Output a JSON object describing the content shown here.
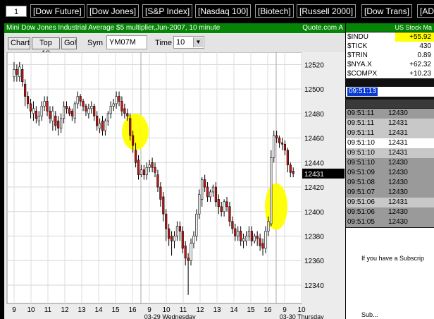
{
  "topbar": {
    "page_number": "1",
    "buttons": [
      "[Dow Future]",
      "[Dow Jones]",
      "[S&P Index]",
      "[Nasdaq 100]",
      "[Biotech]",
      "[Russell 2000]",
      "[Dow Trans]",
      "[AD"
    ]
  },
  "chart_window": {
    "title": "Mini Dow Jones Industrial Average $5 multiplier,Jun-2007, 10 minute",
    "source": "Quote.com  A",
    "chart_button": "Chart",
    "top10_button": "Top 10",
    "go_button": "Go!",
    "sym_label": "Sym",
    "sym_value": "YM07M",
    "time_label": "Time",
    "time_value": "10"
  },
  "chart_data": {
    "type": "candlestick",
    "ylim": [
      12325,
      12530
    ],
    "y_ticks": [
      12520,
      12500,
      12480,
      12460,
      12440,
      12420,
      12400,
      12380,
      12360,
      12340
    ],
    "x_tick_labels": [
      "9",
      "10",
      "11",
      "12",
      "13",
      "14",
      "15",
      "16",
      "9",
      "10",
      "11",
      "12",
      "13",
      "14",
      "15",
      "16",
      "9",
      "10"
    ],
    "x_date_labels": [
      "03-29 Wednesday",
      "03-30 Thursday"
    ],
    "last_price": "12431",
    "highlights": [
      "yellow marker near 12460 at end of day 1",
      "yellow marker near 12400 at end of day 2"
    ],
    "colors": {
      "up": "#ffffff",
      "down": "#cc1111",
      "last_price_bg": "#000000",
      "highlight": "#ffff00"
    },
    "close": [
      12516,
      12512,
      12518,
      12506,
      12494,
      12488,
      12482,
      12484,
      12476,
      12478,
      12486,
      12490,
      12482,
      12476,
      12482,
      12470,
      12468,
      12476,
      12486,
      12484,
      12480,
      12478,
      12488,
      12494,
      12490,
      12486,
      12482,
      12484,
      12486,
      12478,
      12470,
      12472,
      12466,
      12474,
      12480,
      12486,
      12488,
      12494,
      12490,
      12482,
      12480,
      12478,
      12462,
      12454,
      12440,
      12430,
      12434,
      12430,
      12436,
      12438,
      12436,
      12432,
      12420,
      12410,
      12398,
      12386,
      12378,
      12376,
      12380,
      12388,
      12384,
      12370,
      12362,
      12360,
      12374,
      12380,
      12398,
      12414,
      12426,
      12420,
      12412,
      12416,
      12420,
      12408,
      12404,
      12400,
      12408,
      12404,
      12392,
      12386,
      12380,
      12384,
      12376,
      12378,
      12380,
      12384,
      12376,
      12380,
      12378,
      12372,
      12370,
      12384,
      12392,
      12444,
      12462,
      12460,
      12456,
      12455,
      12450,
      12438,
      12432,
      12431
    ],
    "open": [
      12510,
      12516,
      12510,
      12516,
      12504,
      12494,
      12488,
      12480,
      12482,
      12474,
      12478,
      12486,
      12490,
      12482,
      12474,
      12478,
      12474,
      12468,
      12476,
      12486,
      12484,
      12482,
      12476,
      12488,
      12494,
      12490,
      12486,
      12480,
      12484,
      12486,
      12478,
      12468,
      12474,
      12466,
      12474,
      12480,
      12486,
      12488,
      12494,
      12490,
      12484,
      12480,
      12476,
      12462,
      12450,
      12442,
      12430,
      12434,
      12430,
      12436,
      12440,
      12436,
      12430,
      12420,
      12412,
      12398,
      12386,
      12380,
      12376,
      12380,
      12388,
      12384,
      12372,
      12362,
      12360,
      12374,
      12380,
      12398,
      12410,
      12426,
      12420,
      12412,
      12416,
      12420,
      12410,
      12404,
      12400,
      12408,
      12404,
      12392,
      12386,
      12380,
      12384,
      12376,
      12376,
      12380,
      12384,
      12376,
      12380,
      12378,
      12374,
      12370,
      12384,
      12390,
      12444,
      12462,
      12460,
      12456,
      12455,
      12450,
      12438,
      12433
    ],
    "high": [
      12522,
      12520,
      12522,
      12520,
      12508,
      12498,
      12492,
      12490,
      12486,
      12482,
      12490,
      12494,
      12494,
      12486,
      12486,
      12482,
      12478,
      12480,
      12490,
      12490,
      12486,
      12484,
      12490,
      12498,
      12496,
      12492,
      12488,
      12488,
      12490,
      12488,
      12482,
      12476,
      12478,
      12476,
      12482,
      12490,
      12492,
      12498,
      12498,
      12494,
      12488,
      12484,
      12480,
      12466,
      12456,
      12446,
      12438,
      12438,
      12440,
      12442,
      12444,
      12440,
      12434,
      12424,
      12416,
      12402,
      12390,
      12384,
      12384,
      12392,
      12392,
      12388,
      12376,
      12366,
      12378,
      12384,
      12402,
      12418,
      12428,
      12430,
      12424,
      12418,
      12422,
      12424,
      12414,
      12408,
      12410,
      12412,
      12408,
      12396,
      12390,
      12388,
      12388,
      12382,
      12384,
      12388,
      12388,
      12382,
      12384,
      12382,
      12378,
      12388,
      12396,
      12450,
      12466,
      12466,
      12462,
      12460,
      12458,
      12452,
      12440,
      12436
    ],
    "low": [
      12506,
      12506,
      12506,
      12502,
      12486,
      12484,
      12476,
      12474,
      12472,
      12470,
      12474,
      12482,
      12478,
      12472,
      12466,
      12466,
      12462,
      12464,
      12472,
      12480,
      12478,
      12474,
      12472,
      12484,
      12486,
      12482,
      12478,
      12476,
      12480,
      12474,
      12466,
      12464,
      12462,
      12462,
      12470,
      12476,
      12482,
      12484,
      12486,
      12478,
      12476,
      12474,
      12458,
      12448,
      12436,
      12426,
      12428,
      12426,
      12426,
      12432,
      12432,
      12428,
      12416,
      12404,
      12392,
      12376,
      12372,
      12364,
      12370,
      12376,
      12376,
      12366,
      12356,
      12332,
      12356,
      12370,
      12376,
      12394,
      12404,
      12416,
      12408,
      12408,
      12412,
      12404,
      12398,
      12396,
      12396,
      12400,
      12388,
      12382,
      12376,
      12376,
      12372,
      12370,
      12372,
      12376,
      12372,
      12374,
      12372,
      12368,
      12364,
      12366,
      12380,
      12388,
      12440,
      12456,
      12452,
      12450,
      12446,
      12432,
      12428,
      12428
    ]
  },
  "right_panel": {
    "header": "US Stock Ma",
    "indices": [
      {
        "name": "$INDU",
        "value": "+55.92",
        "highlight": true
      },
      {
        "name": "$TICK",
        "value": "430",
        "highlight": false
      },
      {
        "name": "$TRIN",
        "value": "0.89",
        "highlight": false
      },
      {
        "name": "$NYA.X",
        "value": "+62.32",
        "highlight": false
      },
      {
        "name": "$COMPX",
        "value": "+10.23",
        "highlight": false
      }
    ],
    "clock": "09:51:13",
    "ticks": [
      {
        "time": "09:51:11",
        "price": "12430",
        "color": "#9a9a9a"
      },
      {
        "time": "09:51:11",
        "price": "12431",
        "color": "#c8c8c8"
      },
      {
        "time": "09:51:11",
        "price": "12431",
        "color": "#c8c8c8"
      },
      {
        "time": "09:51:10",
        "price": "12431",
        "color": "#ffffff"
      },
      {
        "time": "09:51:10",
        "price": "12431",
        "color": "#c8c8c8"
      },
      {
        "time": "09:51:10",
        "price": "12430",
        "color": "#9a9a9a"
      },
      {
        "time": "09:51:09",
        "price": "12430",
        "color": "#9a9a9a"
      },
      {
        "time": "09:51:08",
        "price": "12430",
        "color": "#9a9a9a"
      },
      {
        "time": "09:51:07",
        "price": "12430",
        "color": "#9a9a9a"
      },
      {
        "time": "09:51:06",
        "price": "12431",
        "color": "#c8c8c8"
      },
      {
        "time": "09:51:06",
        "price": "12430",
        "color": "#9a9a9a"
      },
      {
        "time": "09:51:05",
        "price": "12430",
        "color": "#9a9a9a"
      }
    ],
    "subscription_text": "If you have a Subscrip",
    "bottom_text": "Sub..."
  }
}
